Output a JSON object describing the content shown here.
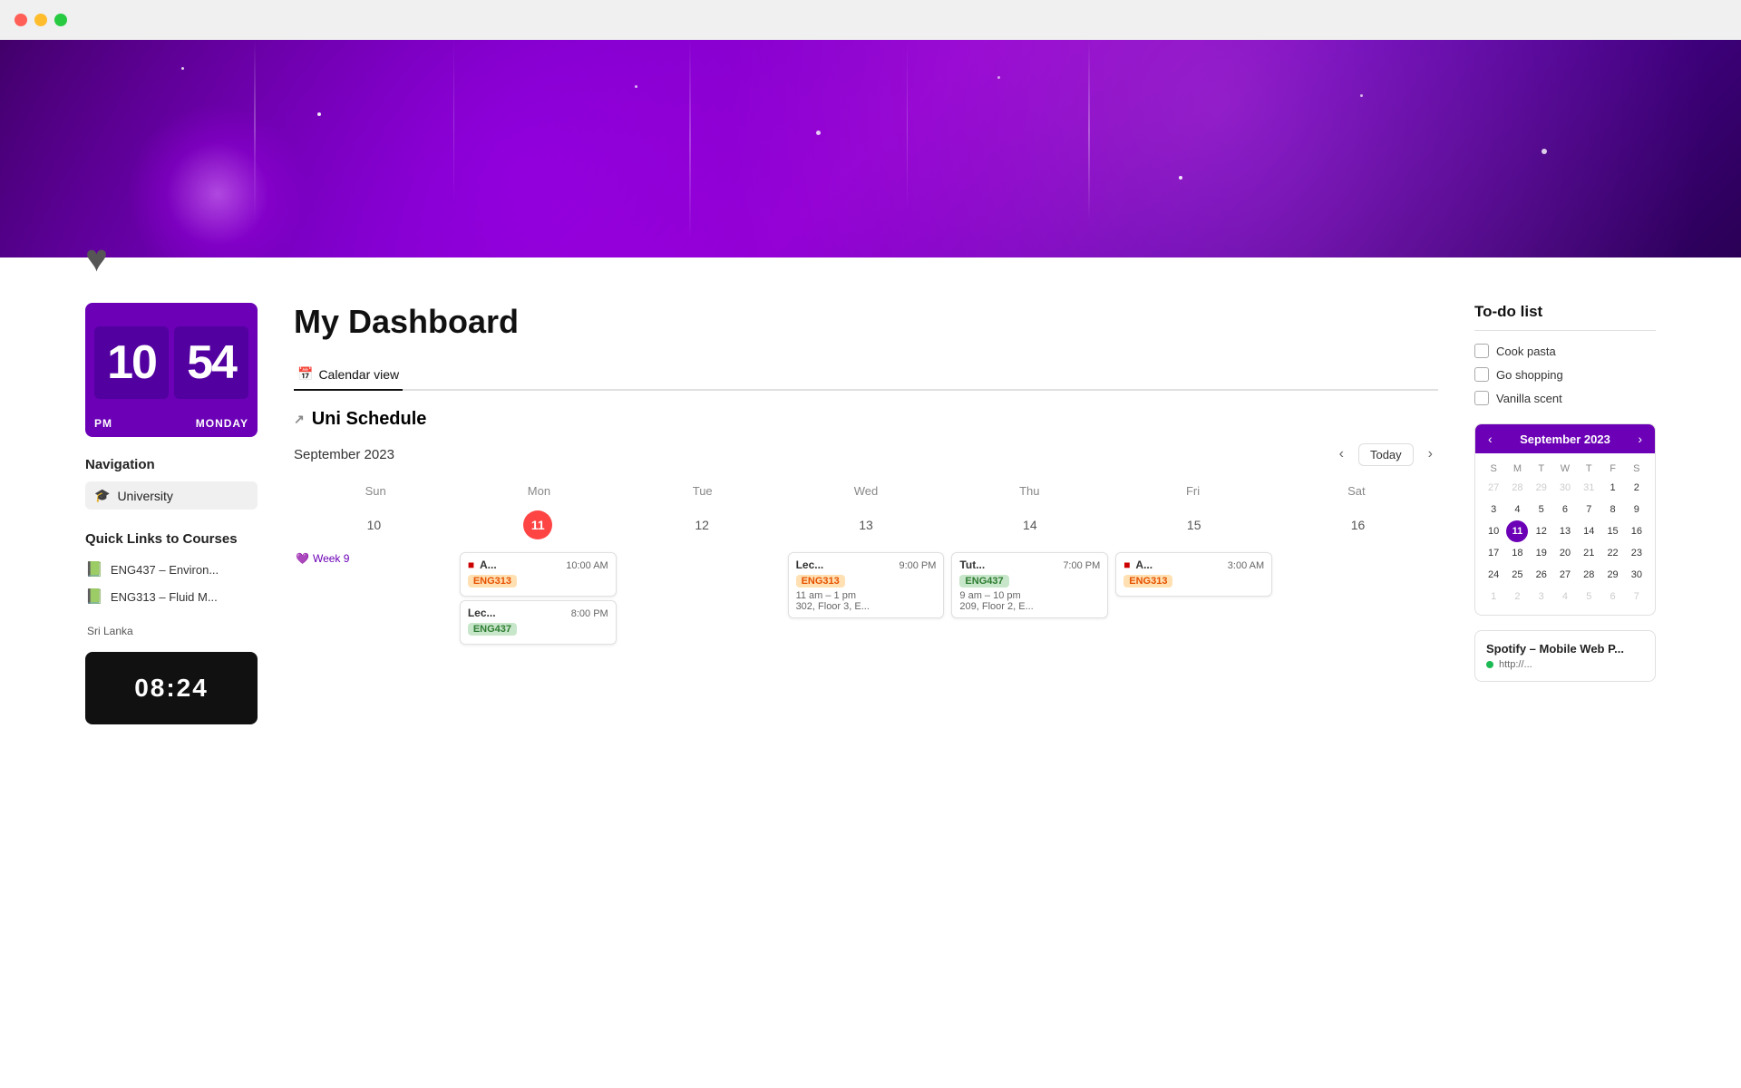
{
  "window": {
    "dots": [
      "red",
      "yellow",
      "green"
    ]
  },
  "clock": {
    "hour": "10",
    "minute": "54",
    "ampm": "PM",
    "day": "MONDAY"
  },
  "dashboard_title": "My Dashboard",
  "navigation": {
    "title": "Navigation",
    "items": [
      {
        "id": "university",
        "label": "University",
        "icon": "🎓"
      }
    ]
  },
  "quick_links": {
    "title": "Quick Links to Courses",
    "items": [
      {
        "id": "eng437",
        "label": "ENG437 – Environ...",
        "icon": "📗"
      },
      {
        "id": "eng313",
        "label": "ENG313 – Fluid M...",
        "icon": "📗"
      }
    ]
  },
  "location_widget": {
    "text": "Sri Lanka",
    "time": "08:24"
  },
  "calendar": {
    "tab_label": "Calendar view",
    "tab_icon": "📅",
    "schedule_title": "Uni Schedule",
    "month_year": "September 2023",
    "today_label": "Today",
    "days": [
      "Sun",
      "Mon",
      "Tue",
      "Wed",
      "Thu",
      "Fri",
      "Sat"
    ],
    "dates": [
      "10",
      "11",
      "12",
      "13",
      "14",
      "15",
      "16"
    ],
    "today_date": "11",
    "week_label": "Week 9",
    "week_icon": "💜",
    "events": {
      "wed": [
        {
          "title": "Lec...",
          "time": "9:00 PM",
          "tag": "ENG313",
          "tag_class": "tag-eng313",
          "detail1": "11 am – 1 pm",
          "detail2": "302, Floor 3, E..."
        }
      ],
      "thu": [
        {
          "title": "Tut...",
          "time": "7:00 PM",
          "tag": "ENG437",
          "tag_class": "tag-eng437",
          "detail1": "9 am – 10 pm",
          "detail2": "209, Floor 2, E..."
        }
      ],
      "fri": [
        {
          "title": "A...",
          "time": "3:00 AM",
          "tag": "ENG313",
          "tag_class": "tag-eng313",
          "detail1": "",
          "detail2": ""
        }
      ],
      "mon": [
        {
          "title": "A...",
          "time": "10:00 AM",
          "tag": "ENG313",
          "tag_class": "tag-eng313",
          "detail1": "",
          "detail2": ""
        },
        {
          "title": "Lec...",
          "time": "8:00 PM",
          "tag": "ENG437",
          "tag_class": "tag-eng437",
          "detail1": "",
          "detail2": ""
        }
      ]
    }
  },
  "todo": {
    "title": "To-do list",
    "items": [
      {
        "id": "cook-pasta",
        "label": "Cook pasta",
        "checked": false
      },
      {
        "id": "go-shopping",
        "label": "Go shopping",
        "checked": false
      },
      {
        "id": "vanilla-scent",
        "label": "Vanilla scent",
        "checked": false
      }
    ]
  },
  "mini_calendar": {
    "month_year": "September 2023",
    "day_headers": [
      "S",
      "M",
      "T",
      "W",
      "T",
      "F",
      "S"
    ],
    "weeks": [
      [
        "27",
        "28",
        "29",
        "30",
        "31",
        "1",
        "2"
      ],
      [
        "3",
        "4",
        "5",
        "6",
        "7",
        "8",
        "9"
      ],
      [
        "10",
        "11",
        "12",
        "13",
        "14",
        "15",
        "16"
      ],
      [
        "17",
        "18",
        "19",
        "20",
        "21",
        "22",
        "23"
      ],
      [
        "24",
        "25",
        "26",
        "27",
        "28",
        "29",
        "30"
      ],
      [
        "1",
        "2",
        "3",
        "4",
        "5",
        "6",
        "7"
      ]
    ],
    "today": "11",
    "prev_month_days": [
      "27",
      "28",
      "29",
      "30",
      "31"
    ],
    "next_month_days": [
      "1",
      "2",
      "3",
      "4",
      "5",
      "6",
      "7"
    ]
  },
  "spotify": {
    "title": "Spotify – Mobile Web P...",
    "status": "listening",
    "status_text": "http://..."
  },
  "colors": {
    "purple": "#6b00b6",
    "today_red": "#ff4444",
    "green_status": "#1db954"
  }
}
